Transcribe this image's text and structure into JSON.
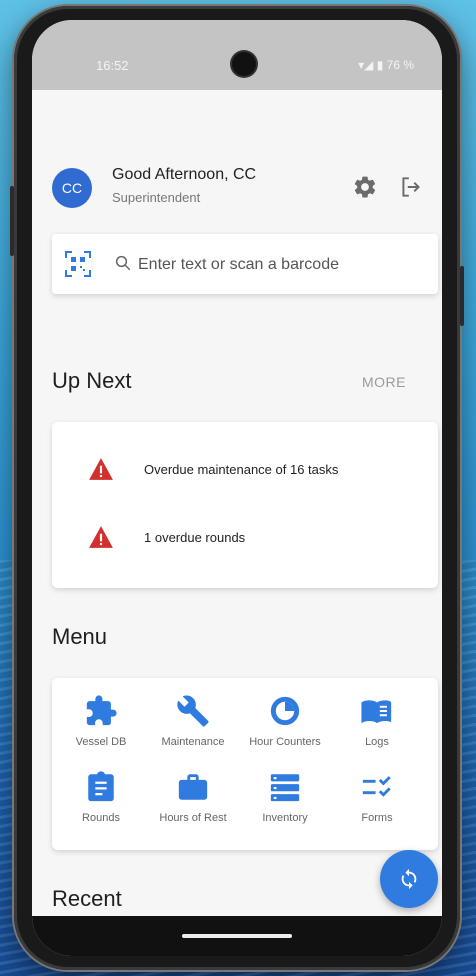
{
  "status": {
    "time": "16:52",
    "icons": "▾◢ ▮ 76 %"
  },
  "user": {
    "initials": "CC",
    "greeting": "Good Afternoon, CC",
    "role": "Superintendent"
  },
  "search": {
    "placeholder": "Enter text or scan a barcode"
  },
  "up_next": {
    "title": "Up Next",
    "more_label": "MORE",
    "items": [
      {
        "text": "Overdue maintenance of 16 tasks",
        "icon": "warning-icon"
      },
      {
        "text": "1 overdue rounds",
        "icon": "warning-icon"
      }
    ]
  },
  "menu": {
    "title": "Menu",
    "items": [
      {
        "label": "Vessel DB",
        "icon": "puzzle-icon"
      },
      {
        "label": "Maintenance",
        "icon": "wrench-icon"
      },
      {
        "label": "Hour Counters",
        "icon": "clock-icon"
      },
      {
        "label": "Logs",
        "icon": "book-icon"
      },
      {
        "label": "Rounds",
        "icon": "clipboard-icon"
      },
      {
        "label": "Hours of Rest",
        "icon": "briefcase-icon"
      },
      {
        "label": "Inventory",
        "icon": "list-icon"
      },
      {
        "label": "Forms",
        "icon": "checklist-icon"
      }
    ]
  },
  "recent": {
    "title": "Recent"
  },
  "colors": {
    "accent": "#2f7be0",
    "warning": "#d32f2f",
    "statusbar": "#c4c4c4"
  }
}
